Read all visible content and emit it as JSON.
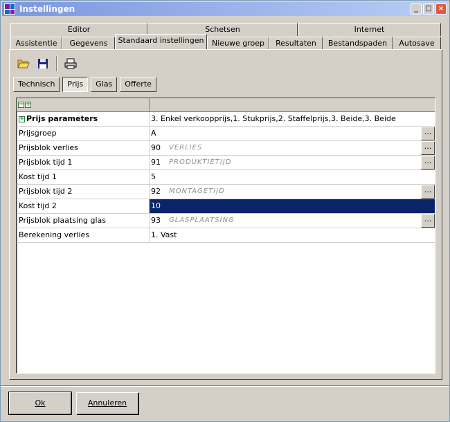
{
  "window": {
    "title": "Instellingen"
  },
  "tabs_top": [
    {
      "label": "Editor"
    },
    {
      "label": "Schetsen"
    },
    {
      "label": "Internet"
    }
  ],
  "tabs_bottom": [
    {
      "label": "Assistentie"
    },
    {
      "label": "Gegevens"
    },
    {
      "label": "Standaard instellingen",
      "active": true
    },
    {
      "label": "Nieuwe groep"
    },
    {
      "label": "Resultaten"
    },
    {
      "label": "Bestandspaden"
    },
    {
      "label": "Autosave"
    }
  ],
  "toolbar": {
    "icons": [
      "open-folder-icon",
      "save-disk-icon",
      "print-icon"
    ]
  },
  "subtabs": [
    {
      "label": "Technisch"
    },
    {
      "label": "Prijs",
      "pressed": true
    },
    {
      "label": "Glas"
    },
    {
      "label": "Offerte"
    }
  ],
  "grid": {
    "header_controls": [
      "collapse-all",
      "expand-all"
    ],
    "rows": [
      {
        "label": "Prijs parameters",
        "value": "3. Enkel verkoopprijs,1. Stukprijs,2. Staffelprijs,3. Beide,3. Beide",
        "group": true
      },
      {
        "label": "Prijsgroep",
        "code": "A",
        "button": true
      },
      {
        "label": "Prijsblok verlies",
        "code": "90",
        "desc": "VERLIES",
        "button": true
      },
      {
        "label": "Prijsblok tijd 1",
        "code": "91",
        "desc": "PRODUKTIETIJD",
        "button": true
      },
      {
        "label": "Kost tijd 1",
        "code": "5"
      },
      {
        "label": "Prijsblok tijd 2",
        "code": "92",
        "desc": "MONTAGETIJD",
        "button": true
      },
      {
        "label": "Kost tijd 2",
        "code": "10",
        "selected": true
      },
      {
        "label": "Prijsblok plaatsing glas",
        "code": "93",
        "desc": "GLASPLAATSING",
        "button": true
      },
      {
        "label": "Berekening verlies",
        "code": "1. Vast"
      }
    ]
  },
  "footer": {
    "ok_label": "Ok",
    "cancel_label": "Annuleren"
  },
  "colors": {
    "selection": "#0a246a",
    "face": "#d4d0c8"
  }
}
